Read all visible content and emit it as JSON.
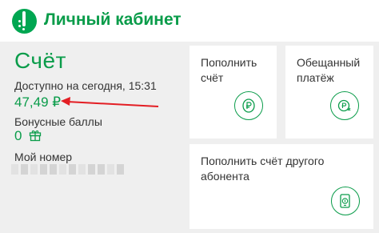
{
  "header": {
    "title": "Личный кабинет",
    "logo_icon": "megafon-logo-icon"
  },
  "account": {
    "title": "Счёт",
    "available_label": "Доступно на сегодня, 15:31",
    "available_value": "47,49 ₽",
    "bonus_label": "Бонусные баллы",
    "bonus_value": "0",
    "bonus_icon": "gift-icon",
    "number_label": "Мой номер",
    "annotation_icon": "red-arrow-icon"
  },
  "cards": [
    {
      "title_lines": [
        "Пополнить",
        "счёт"
      ],
      "icon": "coin-icon"
    },
    {
      "title_lines": [
        "Обещанный",
        "платёж"
      ],
      "icon": "promised-payment-icon"
    },
    {
      "title_lines": [
        "Пополнить счёт другого абонента"
      ],
      "icon": "phone-payment-icon"
    }
  ],
  "colors": {
    "accent": "#0a9c4a",
    "annotation": "#e31e24",
    "background": "#efefef",
    "card": "#ffffff"
  }
}
